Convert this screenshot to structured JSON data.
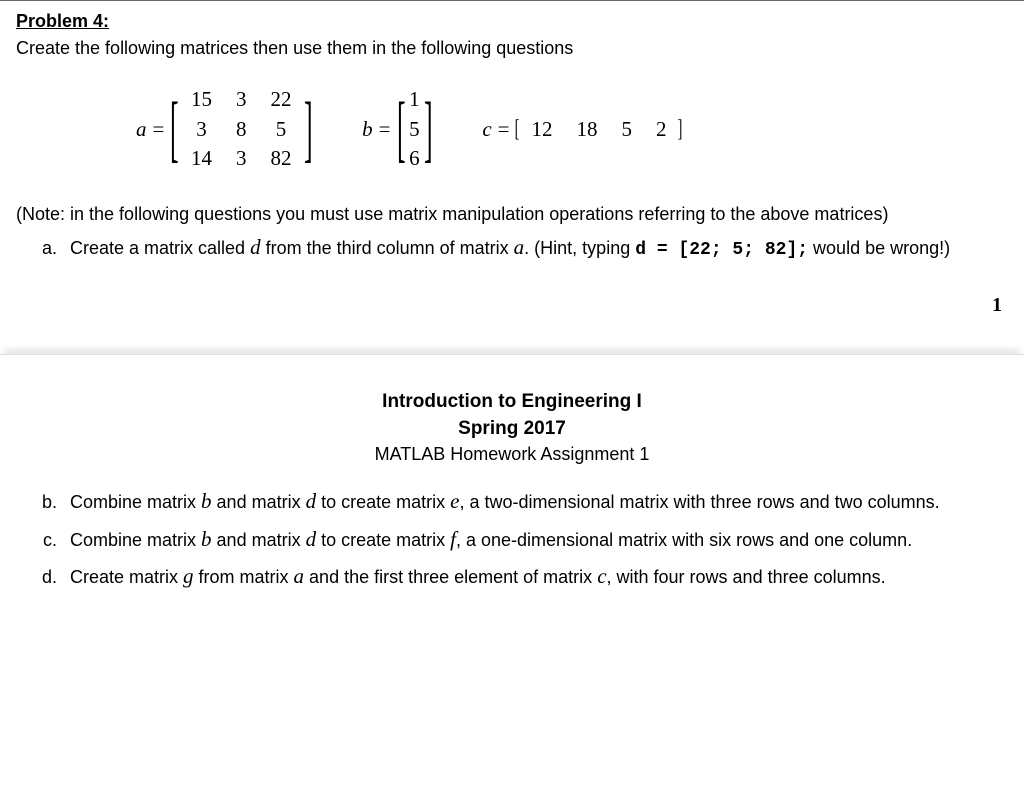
{
  "problem": {
    "title": "Problem 4:",
    "instruction": "Create the following matrices then use them in the following questions"
  },
  "matrices": {
    "a": {
      "label": "a",
      "eq": "=",
      "rows": [
        [
          "15",
          "3",
          "22"
        ],
        [
          "3",
          "8",
          "5"
        ],
        [
          "14",
          "3",
          "82"
        ]
      ]
    },
    "b": {
      "label": "b",
      "eq": "=",
      "rows": [
        [
          "1"
        ],
        [
          "5"
        ],
        [
          "6"
        ]
      ]
    },
    "c": {
      "label": "c",
      "eq": "=",
      "values": [
        "12",
        "18",
        "5",
        "2"
      ]
    }
  },
  "note": "(Note: in the following questions you must use matrix manipulation operations referring to the above matrices)",
  "parts": {
    "a": {
      "pre1": "Create a matrix called ",
      "d": "d",
      "pre2": " from the third column of matrix ",
      "avar": "a",
      "pre3": ". (Hint, typing ",
      "code": "d  =  [22;  5;  82];",
      "post": " would be wrong!)"
    },
    "b": {
      "pre1": "Combine matrix ",
      "b": "b",
      "pre2": " and matrix ",
      "d": "d",
      "pre3": " to create matrix ",
      "e": "e",
      "post": ", a two-dimensional matrix with three rows and two columns."
    },
    "c": {
      "pre1": "Combine matrix ",
      "b": "b",
      "pre2": " and matrix ",
      "d": "d",
      "pre3": " to create matrix ",
      "f": "f",
      "post": ", a one-dimensional matrix with six rows and one column."
    },
    "d": {
      "pre1": "Create matrix ",
      "g": "g",
      "pre2": " from matrix ",
      "avar": "a",
      "pre3": " and the first three element of matrix ",
      "cvar": "c",
      "post": ", with four rows and three columns."
    }
  },
  "page_number": "1",
  "header": {
    "line1": "Introduction to Engineering I",
    "line2": "Spring 2017",
    "line3": "MATLAB Homework Assignment 1"
  }
}
